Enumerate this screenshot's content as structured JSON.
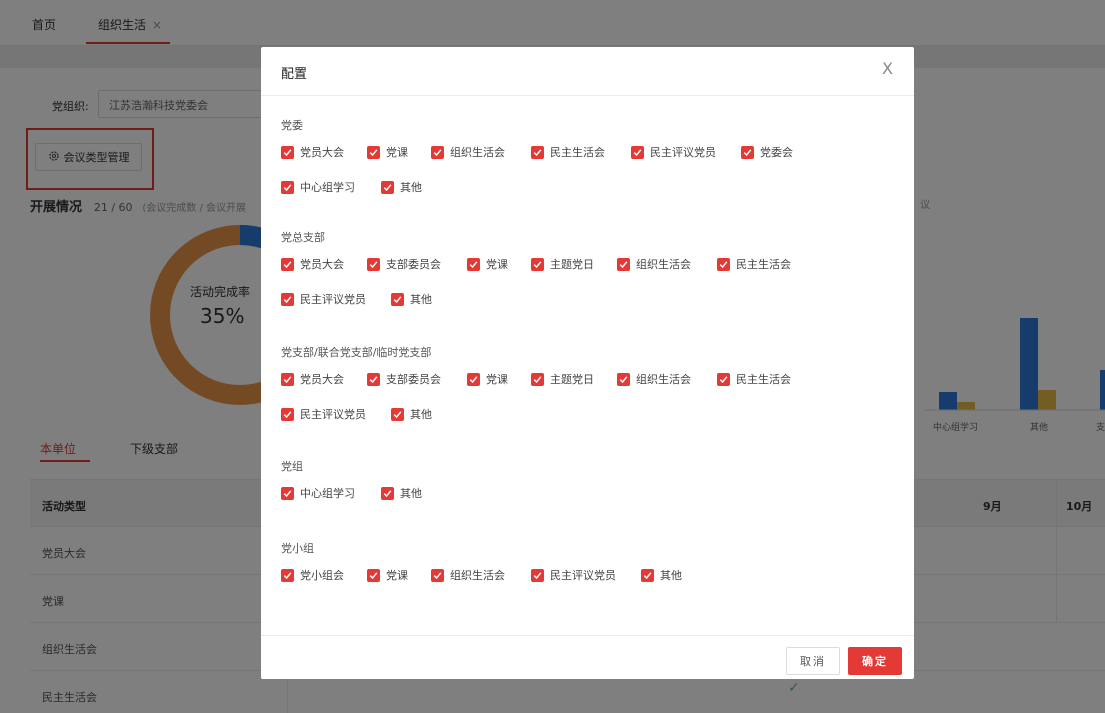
{
  "topbar": {
    "tab_home": "首页",
    "tab_org": "组织生活",
    "tab_close": "×"
  },
  "filter": {
    "party_label": "党组织:",
    "party_value": "江苏浩瀚科技党委会"
  },
  "meeting_type_button": "会议类型管理",
  "progress": {
    "title": "开展情况",
    "count": "21 / 60",
    "note": "(会议完成数 / 会议开展",
    "right_note": "议"
  },
  "donut": {
    "label": "活动完成率",
    "value": "35%",
    "percent": 35
  },
  "bar_chart": {
    "labels": [
      "中心组学习",
      "其他",
      "支"
    ],
    "colors": {
      "blue": "#2a78d4",
      "yellow": "#e8b84a"
    }
  },
  "unit_tabs": {
    "current": "本单位",
    "sub": "下级支部"
  },
  "table": {
    "header": "活动类型",
    "months": [
      "9月",
      "10月"
    ],
    "rows": [
      "党员大会",
      "党课",
      "组织生活会",
      "民主生活会"
    ],
    "check": "✓"
  },
  "modal": {
    "title": "配置",
    "close": "X",
    "sections": [
      {
        "title": "党委",
        "items": [
          "党员大会",
          "党课",
          "组织生活会",
          "民主生活会",
          "民主评议党员",
          "党委会",
          "中心组学习",
          "其他"
        ]
      },
      {
        "title": "党总支部",
        "items": [
          "党员大会",
          "支部委员会",
          "党课",
          "主题党日",
          "组织生活会",
          "民主生活会",
          "民主评议党员",
          "其他"
        ]
      },
      {
        "title": "党支部/联合党支部/临时党支部",
        "items": [
          "党员大会",
          "支部委员会",
          "党课",
          "主题党日",
          "组织生活会",
          "民主生活会",
          "民主评议党员",
          "其他"
        ]
      },
      {
        "title": "党组",
        "items": [
          "中心组学习",
          "其他"
        ]
      },
      {
        "title": "党小组",
        "items": [
          "党小组会",
          "党课",
          "组织生活会",
          "民主评议党员",
          "其他"
        ]
      }
    ],
    "cancel": "取消",
    "ok": "确定"
  },
  "colors": {
    "accent": "#e53935",
    "donut_orange": "#e8954a",
    "donut_blue": "#2a78d4"
  }
}
